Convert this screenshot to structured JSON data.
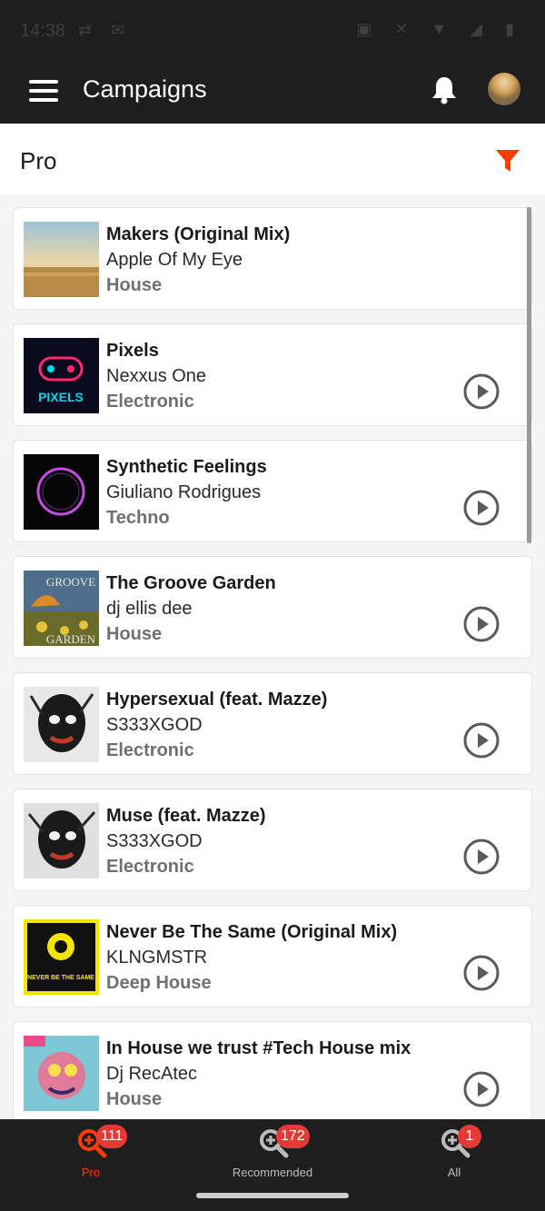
{
  "status_bar": {
    "time": "14:38"
  },
  "app_bar": {
    "title": "Campaigns"
  },
  "subheader": {
    "title": "Pro"
  },
  "colors": {
    "accent": "#ff3d00",
    "badge": "#e53935",
    "bar_bg": "#1e1e1e"
  },
  "tracks": [
    {
      "title": "Makers (Original Mix)",
      "artist": "Apple Of My Eye",
      "genre": "House"
    },
    {
      "title": "Pixels",
      "artist": "Nexxus One",
      "genre": "Electronic",
      "art_text": "PIXELS"
    },
    {
      "title": "Synthetic Feelings",
      "artist": "Giuliano Rodrigues",
      "genre": "Techno"
    },
    {
      "title": "The Groove Garden",
      "artist": "dj ellis dee",
      "genre": "House",
      "art_text_top": "GROOVE",
      "art_text_bottom": "GARDEN"
    },
    {
      "title": "Hypersexual (feat. Mazze)",
      "artist": "S333XGOD",
      "genre": "Electronic"
    },
    {
      "title": "Muse (feat. Mazze)",
      "artist": "S333XGOD",
      "genre": "Electronic"
    },
    {
      "title": "Never Be The Same (Original Mix)",
      "artist": "KLNGMSTR",
      "genre": "Deep House",
      "art_text": "NEVER BE THE SAME"
    },
    {
      "title": "In House we trust #Tech House mix",
      "artist": "Dj RecAtec",
      "genre": "House"
    }
  ],
  "bottom_nav": [
    {
      "label": "Pro",
      "badge": "111"
    },
    {
      "label": "Recommended",
      "badge": "172"
    },
    {
      "label": "All",
      "badge": "1"
    }
  ]
}
